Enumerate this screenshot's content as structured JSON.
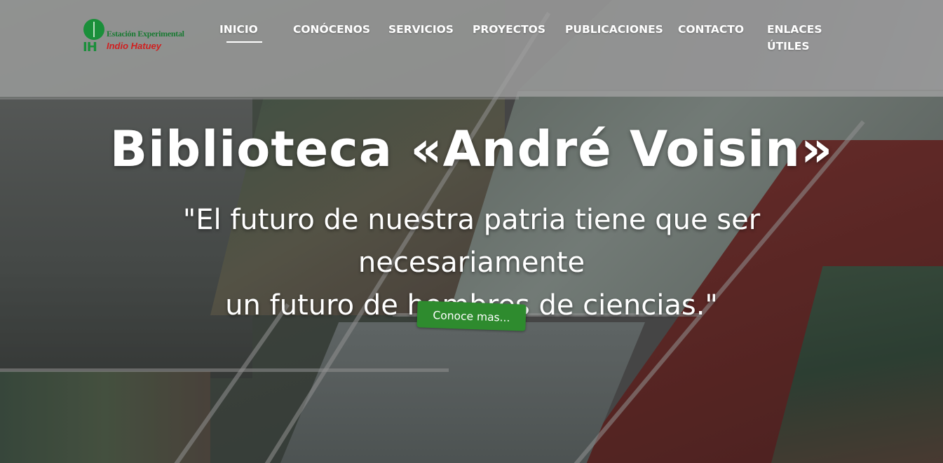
{
  "logo": {
    "line1": "Estación Experimental",
    "line2": "Indio Hatuey",
    "monogram": "IH",
    "leaf_icon": "leaf-icon",
    "brand_green": "#1a8f3a",
    "brand_red": "#d02020"
  },
  "nav": {
    "items": [
      {
        "label": "INICIO",
        "active": true
      },
      {
        "label": "CONÓCENOS",
        "active": false
      },
      {
        "label": "SERVICIOS",
        "active": false
      },
      {
        "label": "PROYECTOS",
        "active": false
      },
      {
        "label": "PUBLICACIONES",
        "active": false
      },
      {
        "label": "CONTACTO",
        "active": false
      },
      {
        "label_line1": "ENLACES",
        "label_line2": "ÚTILES",
        "active": false
      }
    ]
  },
  "hero": {
    "title": "Biblioteca «André Voisin»",
    "quote_line1": "\"El futuro de nuestra patria tiene que ser necesariamente",
    "quote_line2": "un futuro de hombres de ciencias.\"",
    "cta_label": "Conoce mas...",
    "cta_color": "#2e8b2e"
  }
}
